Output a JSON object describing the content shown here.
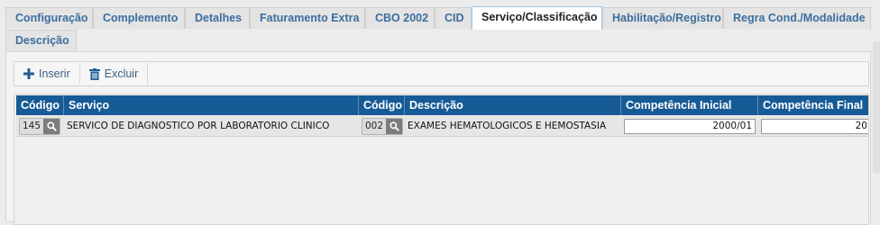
{
  "tabs": {
    "row1": [
      {
        "label": "Configuração",
        "active": false
      },
      {
        "label": "Complemento",
        "active": false
      },
      {
        "label": "Detalhes",
        "active": false
      },
      {
        "label": "Faturamento Extra",
        "active": false
      },
      {
        "label": "CBO 2002",
        "active": false
      },
      {
        "label": "CID",
        "active": false
      },
      {
        "label": "Serviço/Classificação",
        "active": true
      },
      {
        "label": "Habilitação/Registro",
        "active": false
      },
      {
        "label": "Regra Cond./Modalidade",
        "active": false
      }
    ],
    "row2": [
      {
        "label": "Descrição",
        "active": false
      }
    ]
  },
  "toolbar": {
    "insert_label": "Inserir",
    "delete_label": "Excluir"
  },
  "grid": {
    "columns": [
      "Código",
      "Serviço",
      "Código",
      "Descrição",
      "Competência Inicial",
      "Competência Final"
    ],
    "rows": [
      {
        "servico_codigo": "145",
        "servico": "SERVICO DE DIAGNOSTICO POR LABORATORIO CLINICO",
        "classificacao_codigo": "002",
        "descricao": "EXAMES HEMATOLOGICOS E HEMOSTASIA",
        "competencia_inicial": "2000/01",
        "competencia_final": "20"
      }
    ]
  },
  "colors": {
    "tab_text": "#3c6e9e",
    "grid_header": "#175b96",
    "toolbar_text": "#3a5f86"
  }
}
